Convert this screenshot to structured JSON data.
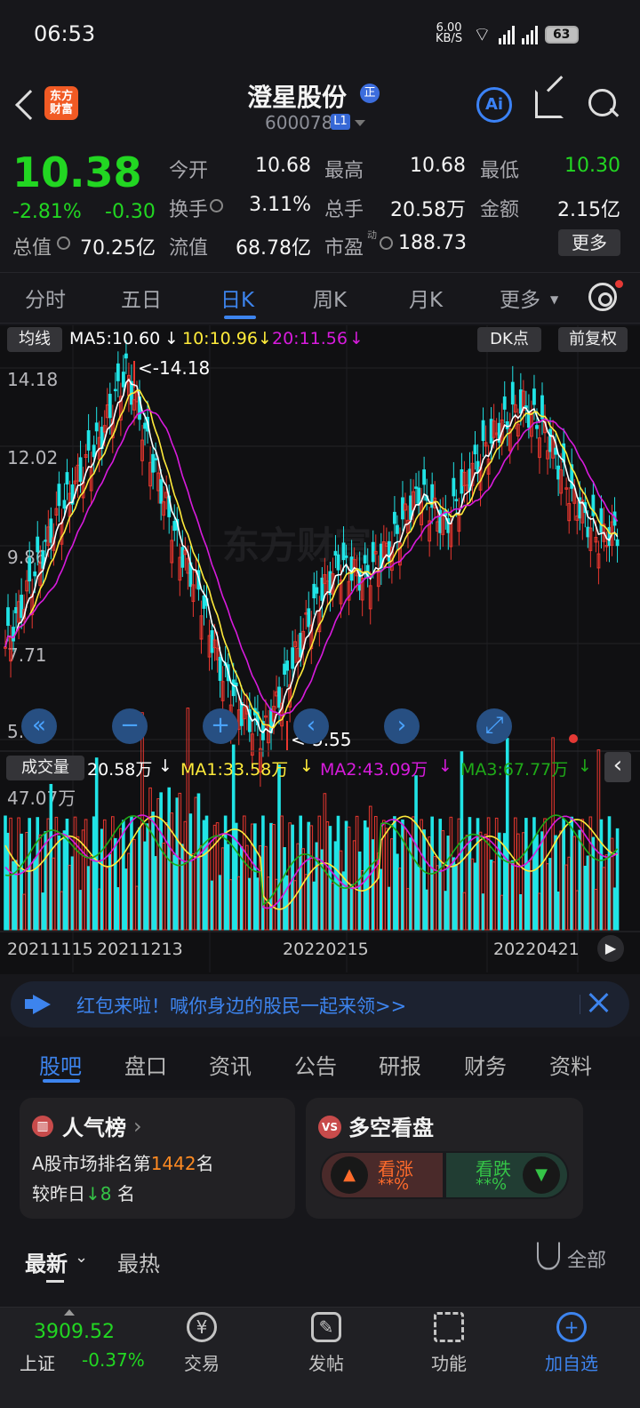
{
  "status": {
    "time": "06:53",
    "speed": "6.00\nKB/S",
    "battery": "63"
  },
  "header": {
    "title": "澄星股份",
    "tag": "正",
    "code": "600078",
    "level": "L1"
  },
  "logo": {
    "text": "东方\n财富"
  },
  "quote": {
    "price": "10.38",
    "change_pct": "-2.81%",
    "change": "-0.30",
    "total_label": "总值",
    "total": "70.25亿",
    "float_label": "流值",
    "float": "68.78亿",
    "pe_label": "市盈",
    "pe_mark": "动",
    "pe": "188.73",
    "more": "更多",
    "rows": [
      [
        "今开",
        "10.68",
        "最高",
        "10.68",
        "最低",
        "10.30"
      ],
      [
        "换手",
        "3.11%",
        "总手",
        "20.58万",
        "金额",
        "2.15亿"
      ]
    ]
  },
  "tabs": [
    "分时",
    "五日",
    "日K",
    "周K",
    "月K",
    "更多"
  ],
  "chart": {
    "line_mode": "均线",
    "ma5": "MA5:10.60",
    "ma10": "10:10.96",
    "ma20": "20:11.56",
    "dk": "DK点",
    "adjust": "前复权",
    "price_axis": [
      "14.18",
      "12.02",
      "9.86",
      "7.71",
      "5.55"
    ],
    "high_label": "<-14.18",
    "low_label": "<-5.55",
    "volume_label": "成交量",
    "volume_value": "20.58万",
    "vma1": "MA1:33.58万",
    "vma2": "MA2:43.09万",
    "vma3": "MA3:67.77万",
    "max_volume": "47.07万",
    "dates": [
      "20211115",
      "20211213",
      "20220215",
      "20220421"
    ],
    "watermark": "东方财富"
  },
  "banner": {
    "text": "红包来啦！喊你身边的股民一起来领>>"
  },
  "bottom_tabs": [
    "股吧",
    "盘口",
    "资讯",
    "公告",
    "研报",
    "财务",
    "资料"
  ],
  "cards": {
    "left": {
      "title": "人气榜",
      "line1_prefix": "A股市场排名第",
      "rank": "1442",
      "line1_suffix": "名",
      "line2_prefix": "较昨日",
      "arrow": "↓",
      "move": "8",
      "line2_suffix": "名"
    },
    "right": {
      "title": "多空看盘",
      "up": "看涨",
      "down": "看跌",
      "up_pct": "**%",
      "down_pct": "**%"
    }
  },
  "feed": {
    "latest": "最新",
    "hot": "最热",
    "filter": "全部"
  },
  "footer": {
    "index": "3909.52",
    "market": "上证",
    "index_change": "-0.37%",
    "items": [
      "交易",
      "发帖",
      "功能",
      "加自选"
    ]
  },
  "colors": {
    "up": "#e9372f",
    "down": "#20e4e6",
    "green": "#22d622",
    "blue": "#3d84ee",
    "ma5": "#ffffff",
    "ma10": "#ffeb3b",
    "ma20": "#d81bdd"
  }
}
